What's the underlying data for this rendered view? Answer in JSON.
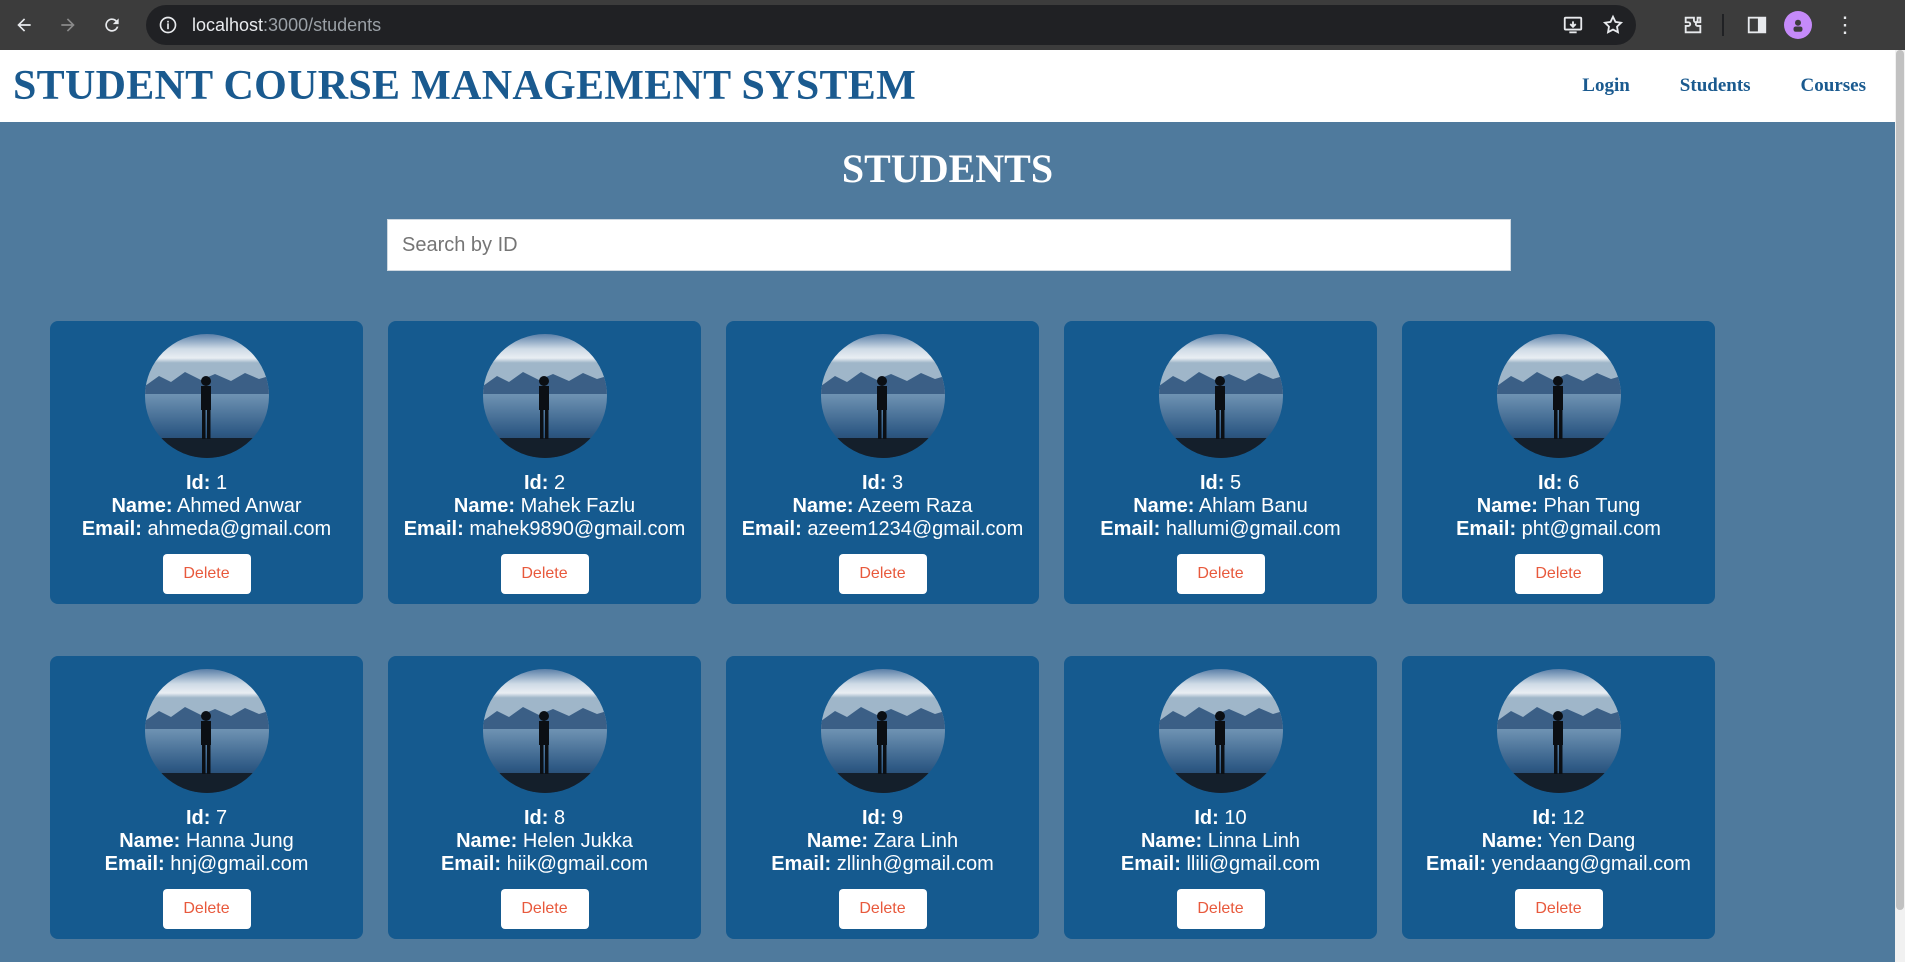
{
  "browser": {
    "url_host": "localhost",
    "url_path": ":3000/students"
  },
  "header": {
    "title": "STUDENT COURSE MANAGEMENT SYSTEM",
    "nav": [
      "Login",
      "Students",
      "Courses"
    ]
  },
  "page": {
    "heading": "STUDENTS",
    "search_placeholder": "Search by ID"
  },
  "labels": {
    "id": "Id:",
    "name": "Name:",
    "email": "Email:",
    "delete": "Delete"
  },
  "students": [
    {
      "id": "1",
      "name": "Ahmed Anwar",
      "email": "ahmeda@gmail.com"
    },
    {
      "id": "2",
      "name": "Mahek Fazlu",
      "email": "mahek9890@gmail.com"
    },
    {
      "id": "3",
      "name": "Azeem Raza",
      "email": "azeem1234@gmail.com"
    },
    {
      "id": "5",
      "name": "Ahlam Banu",
      "email": "hallumi@gmail.com"
    },
    {
      "id": "6",
      "name": "Phan Tung",
      "email": "pht@gmail.com"
    },
    {
      "id": "7",
      "name": "Hanna Jung",
      "email": "hnj@gmail.com"
    },
    {
      "id": "8",
      "name": "Helen Jukka",
      "email": "hiik@gmail.com"
    },
    {
      "id": "9",
      "name": "Zara Linh",
      "email": "zllinh@gmail.com"
    },
    {
      "id": "10",
      "name": "Linna Linh",
      "email": "llili@gmail.com"
    },
    {
      "id": "12",
      "name": "Yen Dang",
      "email": "yendaang@gmail.com"
    }
  ],
  "colors": {
    "page_bg": "#4f7a9d",
    "card_bg": "#155a8f",
    "title_color": "#1a5a8f",
    "delete_text": "#e8593c"
  }
}
